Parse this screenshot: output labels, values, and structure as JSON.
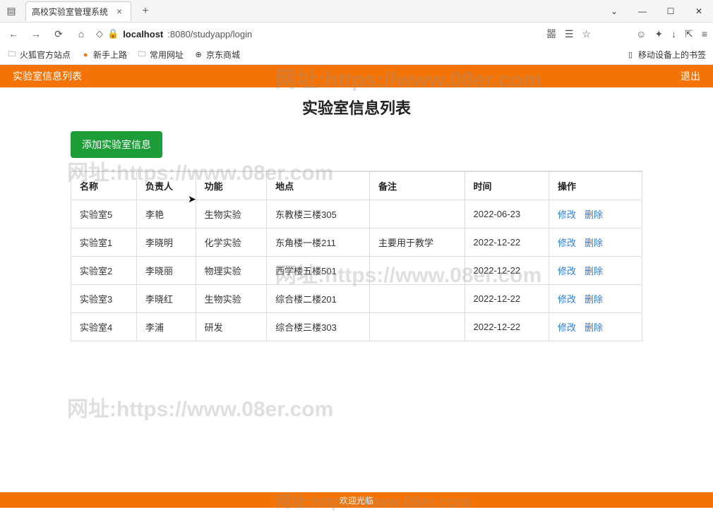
{
  "browser": {
    "tab_title": "高校实验室管理系统",
    "url_host": "localhost",
    "url_port_path": ":8080/studyapp/login",
    "bookmarks": [
      "火狐官方站点",
      "新手上路",
      "常用网址",
      "京东商城"
    ],
    "bookmark_right": "移动设备上的书签"
  },
  "header": {
    "breadcrumb": "实验室信息列表",
    "logout": "退出"
  },
  "page": {
    "title": "实验室信息列表",
    "add_button": "添加实验室信息"
  },
  "table": {
    "headers": [
      "名称",
      "负责人",
      "功能",
      "地点",
      "备注",
      "时间",
      "操作"
    ],
    "rows": [
      {
        "name": "实验室5",
        "owner": "李艳",
        "func": "生物实验",
        "loc": "东教楼三楼305",
        "note": "",
        "time": "2022-06-23"
      },
      {
        "name": "实验室1",
        "owner": "李晓明",
        "func": "化学实验",
        "loc": "东角楼一楼211",
        "note": "主要用于教学",
        "time": "2022-12-22"
      },
      {
        "name": "实验室2",
        "owner": "李晓丽",
        "func": "物理实验",
        "loc": "西学楼五楼501",
        "note": "",
        "time": "2022-12-22"
      },
      {
        "name": "实验室3",
        "owner": "李晓红",
        "func": "生物实验",
        "loc": "综合楼二楼201",
        "note": "",
        "time": "2022-12-22"
      },
      {
        "name": "实验室4",
        "owner": "李浦",
        "func": "研发",
        "loc": "综合楼三楼303",
        "note": "",
        "time": "2022-12-22"
      }
    ],
    "action_edit": "修改",
    "action_delete": "删除"
  },
  "footer": "欢迎光临",
  "watermark": "网址:https://www.08er.com"
}
